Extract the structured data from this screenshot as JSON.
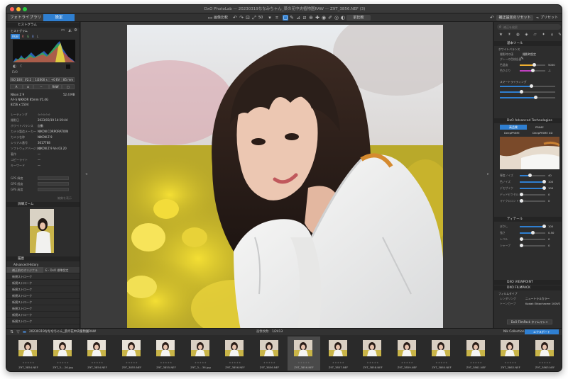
{
  "window": {
    "title": "DxO PhotoLab — 20230319ななみちゃん_菜の花中央植物園RAW — Z9T_3856.NEF (3)"
  },
  "toolbar": {
    "tab_library": "フォトライブラリ",
    "tab_customize": "設定",
    "compare_label": "画像比較",
    "zoom_value": "50",
    "compare_btn": "前比較",
    "reset_btn": "補正設定のリセット",
    "preset_btn": "プリセット",
    "brush_icon": "brush-icon",
    "colors": {
      "accent": "#2f7fd1"
    }
  },
  "left": {
    "histogram_title": "ヒストグラム",
    "histogram_label": "ヒストグラム",
    "channels": [
      "RGB",
      "R",
      "G",
      "B",
      "L"
    ],
    "ev_label": "EV0",
    "exif": [
      "ISO 100",
      "f/2.2",
      "1/2000 s",
      "+0 EV",
      "85 mm"
    ],
    "mode_row": [
      "A",
      "",
      "--",
      "RAW",
      ""
    ],
    "camera": "Nikon Z 9",
    "filesize": "52.4 MB",
    "lens": "AF-S NIKKOR 85mm f/1.4G",
    "dimensions": "8256 x 5504",
    "meta": [
      {
        "label": "レーティング",
        "value": "☆☆☆☆☆"
      },
      {
        "label": "撮影日",
        "value": "2023/03/19 14:19:44"
      },
      {
        "label": "ホワイトバランス",
        "value": "自動"
      },
      {
        "label": "カメラ製造メーカー",
        "value": "NIKON CORPORATION"
      },
      {
        "label": "カメラ名称",
        "value": "NIKON Z 9"
      },
      {
        "label": "シリアル番号",
        "value": "3017788"
      },
      {
        "label": "ソフトウェアバージョン",
        "value": "NIKON Z 9 Ver.03.20"
      },
      {
        "label": "著作",
        "value": "—"
      },
      {
        "label": "コピーライト",
        "value": "—"
      },
      {
        "label": "キーワード",
        "value": "—"
      }
    ],
    "gps": [
      {
        "label": "GPS 緯度"
      },
      {
        "label": "GPS 経度"
      },
      {
        "label": "GPS 高度"
      }
    ],
    "metadata_edit": "編集を表示",
    "detail_zoom_title": "詳細ズーム",
    "history_title": "履歴",
    "advanced_history": "Advanced History",
    "history_items": [
      "補正前のオリジナル",
      "E - DxO 標準設定",
      "新規ストローク",
      "新規ストローク",
      "新規ストローク",
      "新規ストローク",
      "新規ストローク",
      "新規ストローク",
      "新規ストローク",
      "新規ストローク"
    ]
  },
  "right": {
    "search_placeholder": "補正を検索",
    "section_basic": "基本ツール",
    "white_balance": "ホワイトバランス",
    "wb_label": "撮影時の値",
    "wb_value": "撮影時設定",
    "picker_label": "グレーの色検出器",
    "rows1": [
      {
        "label": "色温度",
        "value": "5000"
      },
      {
        "label": "色かぶり",
        "value": "-1"
      }
    ],
    "smart_lighting": "スマートライティング",
    "section_noise": "DxO Advanced Technologies",
    "noise_mode_a": "高品質",
    "noise_mode_b": "PRIME",
    "noise_mode_c": "DeepPRIME",
    "noise_mode_d": "DeepPRIME XD",
    "rows2": [
      {
        "label": "輝度ノイズ",
        "value": "40"
      },
      {
        "label": "色ノイズ",
        "value": "100"
      },
      {
        "label": "デモザイク",
        "value": "100"
      },
      {
        "label": "デッドピクセル",
        "value": "0"
      },
      {
        "label": "マイクロコントラスト",
        "value": "0"
      }
    ],
    "section_detail": "ディテール",
    "rows3": [
      {
        "label": "ぼかし",
        "value": "100"
      },
      {
        "label": "強さ",
        "value": "0.50"
      },
      {
        "label": "レベル",
        "value": "0"
      },
      {
        "label": "シャープ",
        "value": "0"
      }
    ],
    "section_viewpoint": "DXO VIEWPOINT",
    "section_filmpack": "DXO FILMPACK",
    "film_label": "フィルムタイプ",
    "film_value": "DxO FilmPack タイムマシン",
    "film_rows": [
      {
        "label": "レンダリング",
        "value": "ニュートラルカラー"
      },
      {
        "label": "トーンカーブ",
        "value": "Kodak Ektachrome 100VS"
      }
    ],
    "film_btn": "DxO FilmPack タイムマシン"
  },
  "bottombar": {
    "path": "20230319なななちゃん_菜の花中央植物園RAW",
    "counter_label": "画像枚数:",
    "counter": "1/2413",
    "collection": "Nik Collection",
    "export_btn": "エクスポート"
  },
  "filmstrip": {
    "thumbs": [
      "Z9T_3854.NEF",
      "Z9T_3...-26.jpg",
      "Z9T_3854.NEF",
      "Z9T_3855.NEF",
      "Z9T_3855.NEF",
      "Z9T_3...-36.jpg",
      "Z9T_3856.NEF",
      "Z9T_3856.NEF",
      "Z9T_3856.NEF",
      "Z9T_3857.NEF",
      "Z9T_3858.NEF",
      "Z9T_3859.NEF",
      "Z9T_3860.NEF",
      "Z9T_3861.NEF",
      "Z9T_3862.NEF",
      "Z9T_3863.NEF"
    ],
    "stars": "★★★★★"
  }
}
